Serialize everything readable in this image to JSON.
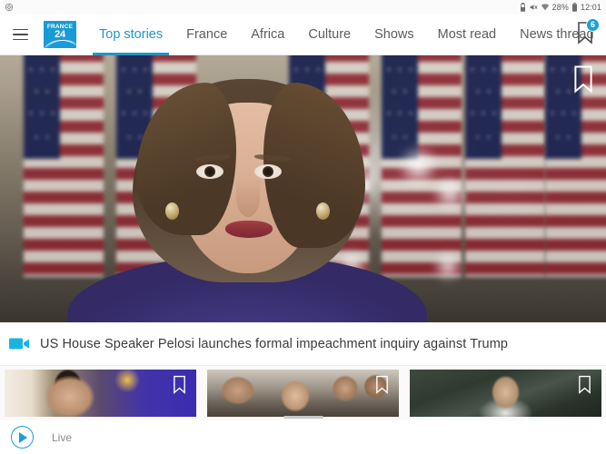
{
  "status_bar": {
    "left_icons": [
      "camera-lens-icon"
    ],
    "right_icons": [
      "battery-saver-icon",
      "mute-icon",
      "wifi-icon",
      "battery-icon"
    ],
    "battery_percent": "28%",
    "time": "12:01"
  },
  "nav": {
    "menu_icon": "hamburger-menu-icon",
    "logo": {
      "line1": "FRANCE",
      "line2": "24"
    },
    "tabs": [
      {
        "label": "Top stories",
        "active": true
      },
      {
        "label": "France",
        "active": false
      },
      {
        "label": "Africa",
        "active": false
      },
      {
        "label": "Culture",
        "active": false
      },
      {
        "label": "Shows",
        "active": false
      },
      {
        "label": "Most read",
        "active": false
      },
      {
        "label": "News thread",
        "active": false
      }
    ],
    "bookmark_badge_count": "6",
    "accent_color": "#2196c4"
  },
  "hero": {
    "bookmark_icon": "bookmark-outline-icon",
    "alt": "Nancy Pelosi speaking in front of US flags"
  },
  "headline": {
    "video_icon": "video-camera-icon",
    "text": "US House Speaker Pelosi launches formal impeachment inquiry against Trump"
  },
  "thumbnails": [
    {
      "name": "thumbnail-card-1",
      "bookmark_icon": "bookmark-outline-icon"
    },
    {
      "name": "thumbnail-card-2",
      "bookmark_icon": "bookmark-outline-icon"
    },
    {
      "name": "thumbnail-card-3",
      "bookmark_icon": "bookmark-outline-icon"
    }
  ],
  "bottom_bar": {
    "play_icon": "play-circle-icon",
    "live_label": "Live"
  }
}
